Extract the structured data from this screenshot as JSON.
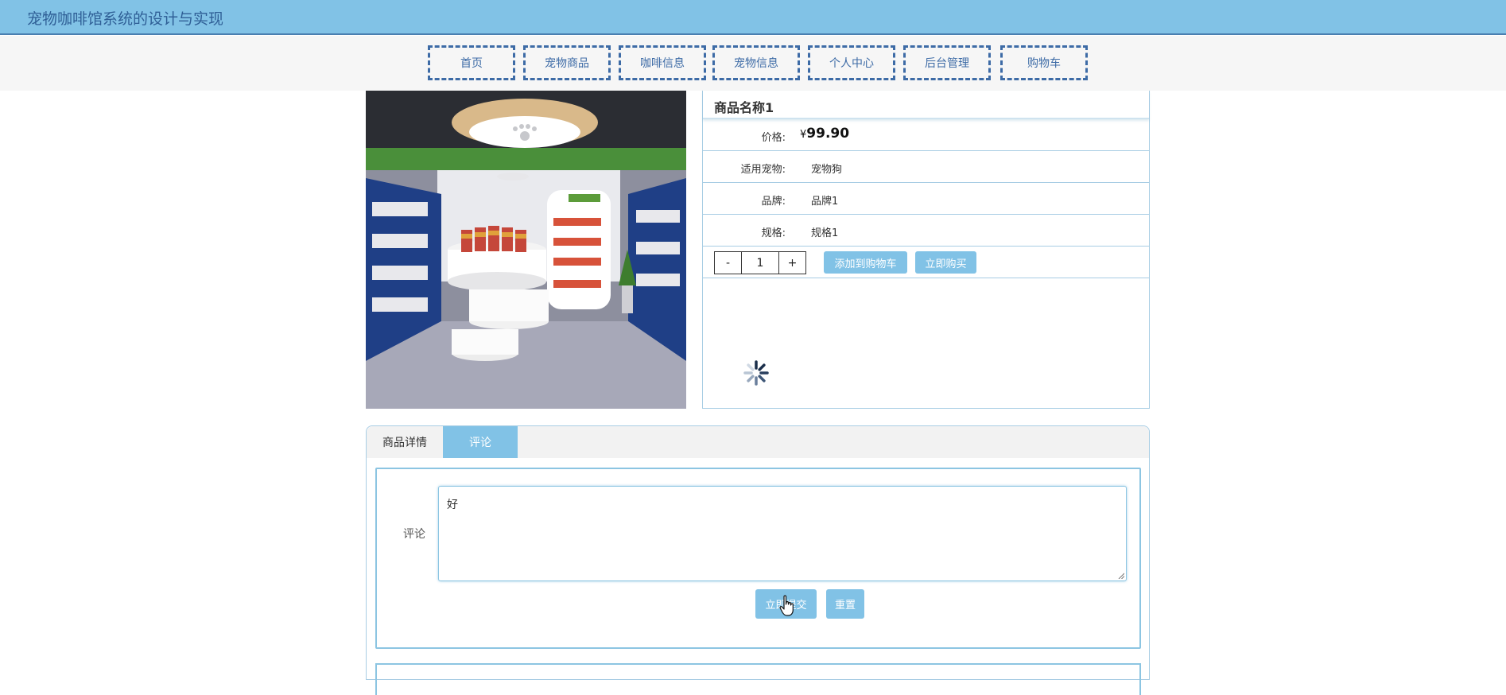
{
  "header": {
    "title": "宠物咖啡馆系统的设计与实现"
  },
  "nav": [
    {
      "label": "首页"
    },
    {
      "label": "宠物商品"
    },
    {
      "label": "咖啡信息"
    },
    {
      "label": "宠物信息"
    },
    {
      "label": "个人中心"
    },
    {
      "label": "后台管理"
    },
    {
      "label": "购物车"
    }
  ],
  "product": {
    "name": "商品名称1",
    "price_label": "价格:",
    "currency": "¥",
    "price": "99.90",
    "pet_label": "适用宠物:",
    "pet": "宠物狗",
    "brand_label": "品牌:",
    "brand": "品牌1",
    "spec_label": "规格:",
    "spec": "规格1",
    "minus": "-",
    "quantity": "1",
    "plus": "+",
    "add_to_cart": "添加到购物车",
    "buy_now": "立即购买"
  },
  "tabs": [
    {
      "label": "商品详情",
      "active": false
    },
    {
      "label": "评论",
      "active": true
    }
  ],
  "comment_form": {
    "label": "评论",
    "value": "好",
    "submit": "立即提交",
    "reset": "重置"
  },
  "colors": {
    "primary": "#81c2e6",
    "nav_text": "#3d6ba6",
    "border": "#a8cde4"
  }
}
